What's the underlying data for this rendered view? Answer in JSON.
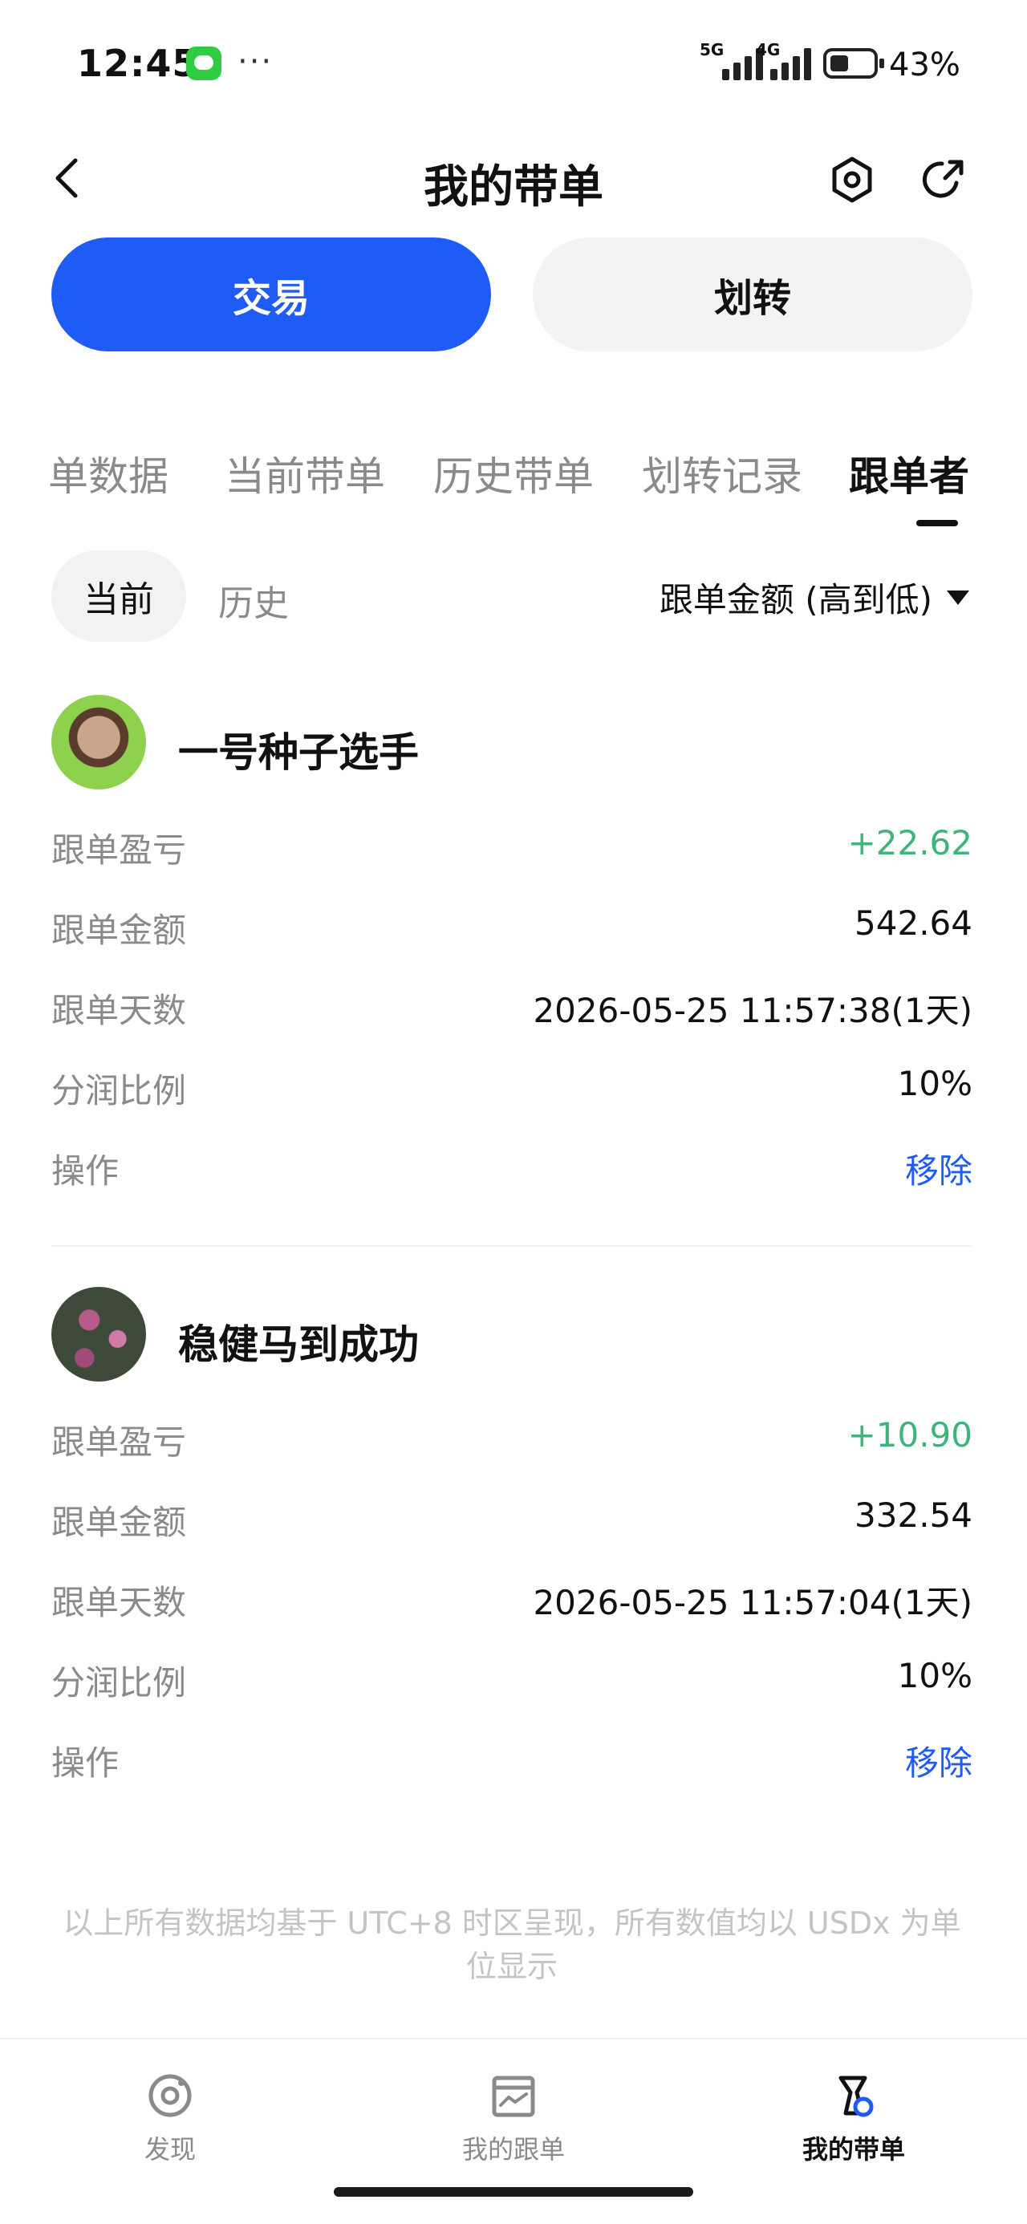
{
  "status_bar": {
    "time": "12:45",
    "more": "···",
    "network_1": "5G",
    "network_2": "4G",
    "battery_level": "43%"
  },
  "header": {
    "title": "我的带单",
    "icons": [
      "back-icon",
      "settings-icon",
      "share-icon"
    ]
  },
  "actions": {
    "trade_label": "交易",
    "transfer_label": "划转",
    "primary_color": "#1f5bf5"
  },
  "tabs": [
    {
      "label": "单数据",
      "active": false
    },
    {
      "label": "当前带单",
      "active": false
    },
    {
      "label": "历史带单",
      "active": false
    },
    {
      "label": "划转记录",
      "active": false
    },
    {
      "label": "跟单者",
      "active": true
    }
  ],
  "filter": {
    "current_label": "当前",
    "history_label": "历史",
    "sort_label": "跟单金额 (高到低)"
  },
  "followers": [
    {
      "name": "一号种子选手",
      "rows": [
        {
          "label": "跟单盈亏",
          "value": "+22.62"
        },
        {
          "label": "跟单金额",
          "value": "542.64"
        },
        {
          "label": "跟单天数",
          "value": "2026-05-25 11:57:38(1天)"
        },
        {
          "label": "分润比例",
          "value": "10%"
        },
        {
          "label": "操作",
          "value": "移除"
        }
      ]
    },
    {
      "name": "稳健马到成功",
      "rows": [
        {
          "label": "跟单盈亏",
          "value": "+10.90"
        },
        {
          "label": "跟单金额",
          "value": "332.54"
        },
        {
          "label": "跟单天数",
          "value": "2026-05-25 11:57:04(1天)"
        },
        {
          "label": "分润比例",
          "value": "10%"
        },
        {
          "label": "操作",
          "value": "移除"
        }
      ]
    }
  ],
  "footnote": "以上所有数据均基于 UTC+8 时区呈现，所有数值均以 USDx 为单位显示",
  "bottom_nav": [
    {
      "label": "发现",
      "icon": "discover-icon",
      "active": false
    },
    {
      "label": "我的跟单",
      "icon": "copy-orders-icon",
      "active": false
    },
    {
      "label": "我的带单",
      "icon": "lead-orders-icon",
      "active": true
    }
  ],
  "colors": {
    "profit": "#3eb37a",
    "link": "#1f5bf5",
    "muted": "#8a8a8a"
  }
}
